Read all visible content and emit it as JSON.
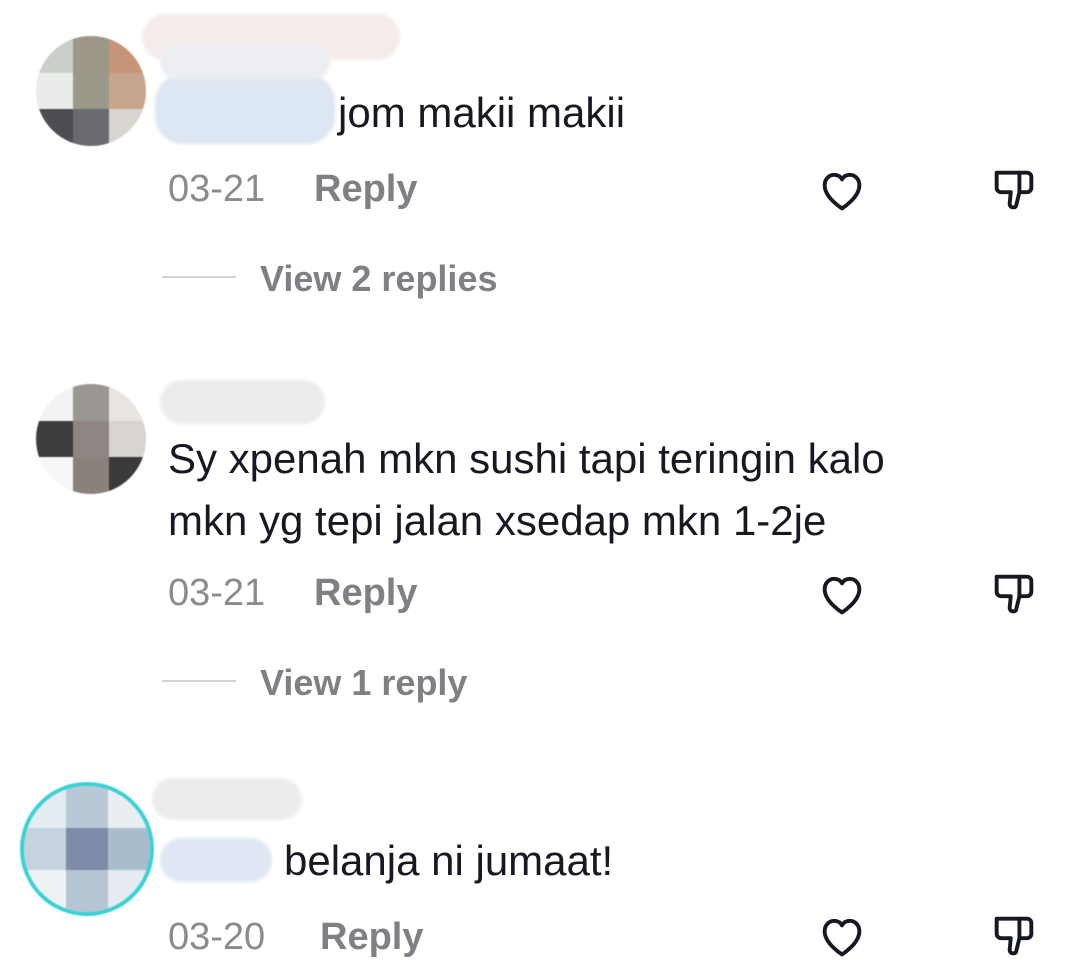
{
  "comments": [
    {
      "text": "jom makii makii",
      "date": "03-21",
      "reply_label": "Reply",
      "view_replies": "View 2 replies"
    },
    {
      "text_lines": [
        "Sy xpenah mkn sushi tapi teringin kalo",
        "mkn yg tepi jalan xsedap mkn 1-2je"
      ],
      "date": "03-21",
      "reply_label": "Reply",
      "view_replies": "View 1 reply"
    },
    {
      "text": "belanja ni jumaat!",
      "date": "03-20",
      "reply_label": "Reply"
    }
  ],
  "icons": {
    "like": "heart-outline-icon",
    "dislike": "thumbs-down-outline-icon"
  },
  "colors": {
    "text": "#161823",
    "meta": "#8a8b91",
    "avatar_ring": "#3ad1d6"
  }
}
